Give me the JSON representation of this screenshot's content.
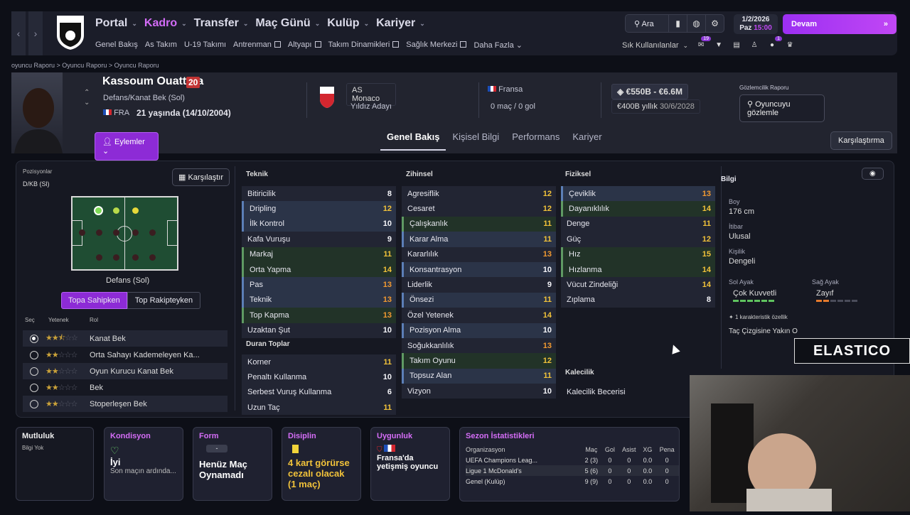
{
  "nav": {
    "menu": [
      "Portal",
      "Kadro",
      "Transfer",
      "Maç Günü",
      "Kulüp",
      "Kariyer"
    ],
    "sub": [
      "Genel Bakış",
      "As Takım",
      "U-19 Takımı",
      "Antrenman",
      "Altyapı",
      "Takım Dinamikleri",
      "Sağlık Merkezi",
      "Daha Fazla"
    ],
    "search": "Ara",
    "date": "1/2/2026",
    "day": "Paz",
    "time": "15:00",
    "continue": "Devam",
    "quick": "Sık Kullanılanlar",
    "badge1": "19",
    "badge2": "1"
  },
  "breadcrumb": "oyuncu Raporu  >  Oyuncu Raporu  >  Oyuncu Raporu",
  "player": {
    "name": "Kassoum Ouattara",
    "number": "20",
    "position": "Defans/Kanat Bek (Sol)",
    "nation_code": "FRA",
    "age": "21 yaşında (14/10/2004)",
    "club": "AS Monaco",
    "club_status": "Yıldız Adayı",
    "nation": "Fransa",
    "caps": "0 maç / 0 gol",
    "value": "€550B - €6.6M",
    "wage": "€400B yıllık",
    "contract": "30/6/2028",
    "scout_label": "Gözlemcilik Raporu",
    "scout_button": "Oyuncuyu gözlemle",
    "actions": "Eylemler"
  },
  "tabs": [
    "Genel Bakış",
    "Kişisel Bilgi",
    "Performans",
    "Kariyer"
  ],
  "compare_button": "Karşılaştırma",
  "positions": {
    "label": "Pozisyonlar",
    "value": "D/KB (Sl)",
    "compare": "Karşılaştır",
    "pitch_caption": "Defans (Sol)",
    "toggle_on": "Topa Sahipken",
    "toggle_off": "Top Rakipteyken",
    "head_sec": "Seç",
    "head_yetenek": "Yetenek",
    "head_rol": "Rol",
    "roles": [
      {
        "name": "Kanat Bek",
        "stars": 2.5,
        "sel": true
      },
      {
        "name": "Orta Sahayı Kademeleyen Ka...",
        "stars": 2,
        "sel": false
      },
      {
        "name": "Oyun Kurucu Kanat Bek",
        "stars": 2,
        "sel": false
      },
      {
        "name": "Bek",
        "stars": 2,
        "sel": false
      },
      {
        "name": "Stoperleşen Bek",
        "stars": 2,
        "sel": false
      }
    ]
  },
  "attributes": {
    "teknik": {
      "title": "Teknik",
      "items": [
        [
          "Bitiricilik",
          "8",
          "z",
          "w"
        ],
        [
          "Dripling",
          "12",
          "b",
          "y"
        ],
        [
          "İlk Kontrol",
          "10",
          "b",
          "w"
        ],
        [
          "Kafa Vuruşu",
          "9",
          "z",
          "w"
        ],
        [
          "Markaj",
          "11",
          "g",
          "y"
        ],
        [
          "Orta Yapma",
          "14",
          "g",
          "y"
        ],
        [
          "Pas",
          "13",
          "b",
          "o"
        ],
        [
          "Teknik",
          "13",
          "b",
          "o"
        ],
        [
          "Top Kapma",
          "13",
          "g",
          "o"
        ],
        [
          "Uzaktan Şut",
          "10",
          "z",
          "w"
        ]
      ]
    },
    "duran": {
      "title": "Duran Toplar",
      "items": [
        [
          "Korner",
          "11",
          "z",
          "y"
        ],
        [
          "Penaltı Kullanma",
          "10",
          "z",
          "w"
        ],
        [
          "Serbest Vuruş Kullanma",
          "6",
          "z",
          "w"
        ],
        [
          "Uzun Taç",
          "11",
          "z",
          "y"
        ]
      ]
    },
    "zihinsel": {
      "title": "Zihinsel",
      "items": [
        [
          "Agresiflik",
          "12",
          "z",
          "y"
        ],
        [
          "Cesaret",
          "12",
          "z",
          "y"
        ],
        [
          "Çalışkanlık",
          "11",
          "g",
          "y"
        ],
        [
          "Karar Alma",
          "11",
          "b",
          "y"
        ],
        [
          "Kararlılık",
          "13",
          "z",
          "o"
        ],
        [
          "Konsantrasyon",
          "10",
          "b",
          "w"
        ],
        [
          "Liderlik",
          "9",
          "z",
          "w"
        ],
        [
          "Önsezi",
          "11",
          "b",
          "y"
        ],
        [
          "Özel Yetenek",
          "14",
          "z",
          "y"
        ],
        [
          "Pozisyon Alma",
          "10",
          "b",
          "w"
        ],
        [
          "Soğukkanlılık",
          "13",
          "z",
          "o"
        ],
        [
          "Takım Oyunu",
          "12",
          "g",
          "y"
        ],
        [
          "Topsuz Alan",
          "11",
          "b",
          "y"
        ],
        [
          "Vizyon",
          "10",
          "z",
          "w"
        ]
      ]
    },
    "fiziksel": {
      "title": "Fiziksel",
      "items": [
        [
          "Çeviklik",
          "13",
          "b",
          "o"
        ],
        [
          "Dayanıklılık",
          "14",
          "g",
          "y"
        ],
        [
          "Denge",
          "11",
          "z",
          "y"
        ],
        [
          "Güç",
          "12",
          "z",
          "y"
        ],
        [
          "Hız",
          "15",
          "g",
          "y"
        ],
        [
          "Hızlanma",
          "14",
          "g",
          "y"
        ],
        [
          "Vücut Zindeliği",
          "14",
          "z",
          "y"
        ],
        [
          "Zıplama",
          "8",
          "z",
          "w"
        ]
      ]
    },
    "kalecilik": {
      "title": "Kalecilik",
      "items": [
        [
          "Kalecilik Becerisi",
          ""
        ]
      ]
    }
  },
  "info": {
    "title": "Bilgi",
    "height_l": "Boy",
    "height": "176 cm",
    "rep_l": "İtibar",
    "rep": "Ulusal",
    "pers_l": "Kişilik",
    "pers": "Dengeli",
    "left_l": "Sol Ayak",
    "left": "Çok Kuvvetli",
    "right_l": "Sağ Ayak",
    "right": "Zayıf",
    "traits": "1 karakteristik özellik",
    "trait": "Taç Çizgisine Yakın O"
  },
  "cards": {
    "mutluluk": "Mutluluk",
    "mutluluk_v": "Bilgi Yok",
    "kondisyon": "Kondisyon",
    "kondisyon_v": "İyi",
    "kondisyon_s": "Son maçın ardında...",
    "form": "Form",
    "form_v": "Henüz Maç Oynamadı",
    "form_badge": "-",
    "disiplin": "Disiplin",
    "disiplin_v": "4 kart görürse cezalı olacak (1 maç)",
    "uygunluk": "Uygunluk",
    "uygunluk_v": "Fransa'da yetişmiş oyuncu",
    "sezon": "Sezon İstatistikleri"
  },
  "season": {
    "headers": [
      "Organizasyon",
      "Maç",
      "Gol",
      "Asist",
      "XG",
      "Pena"
    ],
    "rows": [
      [
        "UEFA Champions Leag...",
        "2 (3)",
        "0",
        "0",
        "0.0",
        "0"
      ],
      [
        "Ligue 1 McDonald's",
        "5 (6)",
        "0",
        "0",
        "0.0",
        "0"
      ],
      [
        "Genel (Kulüp)",
        "9 (9)",
        "0",
        "0",
        "0.0",
        "0"
      ]
    ]
  },
  "overlay": {
    "brand": "ELASTICO"
  },
  "colors": {
    "accent": "#c147f4",
    "yellow": "#f1c23a",
    "orange": "#f29a31"
  }
}
